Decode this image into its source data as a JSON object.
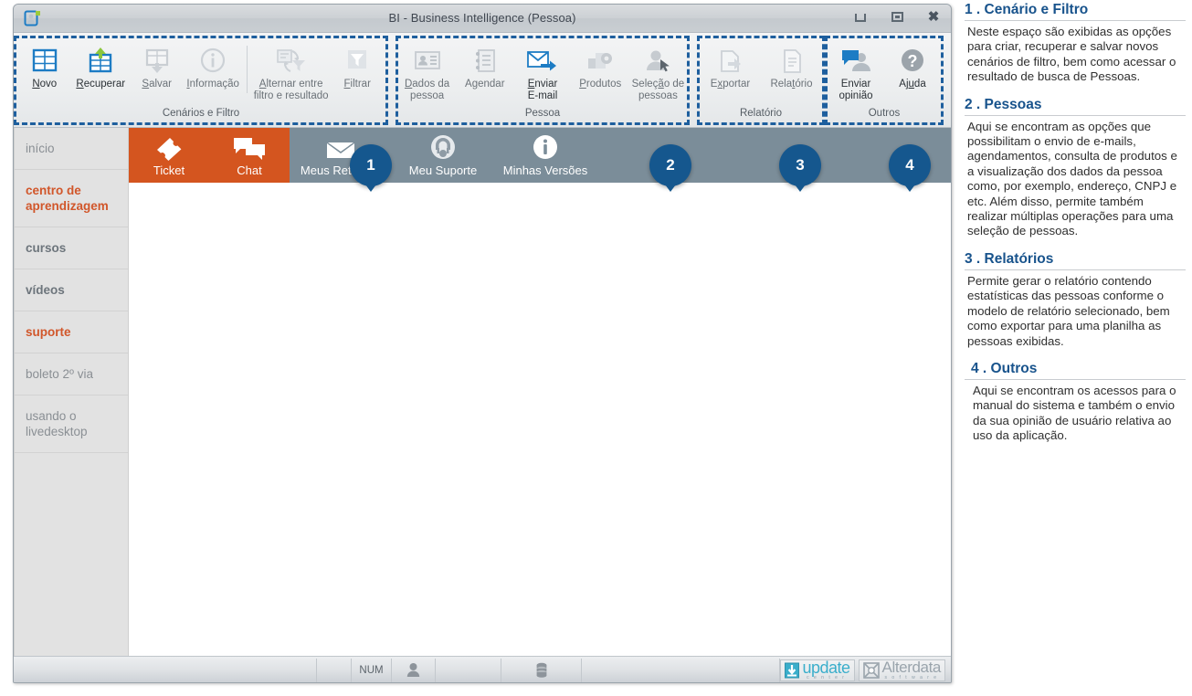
{
  "window": {
    "title": "BI - Business Intelligence (Pessoa)",
    "app_icon": "contact-card-icon",
    "controls": {
      "minimize": "minimize-icon",
      "restore": "restore-icon",
      "close": "close-icon"
    }
  },
  "ribbon": {
    "groups": [
      {
        "id": "cenarios",
        "label": "Cenários e Filtro",
        "badge": "1",
        "buttons": [
          {
            "label": "Novo",
            "accel": "N",
            "icon": "table-new-icon",
            "enabled": true
          },
          {
            "label": "Recuperar",
            "accel": "R",
            "icon": "table-retrieve-icon",
            "enabled": true
          },
          {
            "label": "Salvar",
            "accel": "S",
            "icon": "table-save-icon",
            "enabled": false
          },
          {
            "label": "Informação",
            "accel": "I",
            "icon": "info-circle-icon",
            "enabled": false
          },
          {
            "label": "Alternar entre filtro e resultado",
            "accel": "A",
            "icon": "toggle-filter-result-icon",
            "enabled": false
          },
          {
            "label": "Filtrar",
            "accel": "F",
            "icon": "funnel-icon",
            "enabled": false
          }
        ]
      },
      {
        "id": "pessoa",
        "label": "Pessoa",
        "badge": "2",
        "buttons": [
          {
            "label": "Dados da pessoa",
            "accel": "D",
            "icon": "contact-details-icon",
            "enabled": false
          },
          {
            "label": "Agendar",
            "accel": "g",
            "icon": "agenda-book-icon",
            "enabled": false
          },
          {
            "label": "Enviar E-mail",
            "accel": "E",
            "icon": "send-email-icon",
            "enabled": true
          },
          {
            "label": "Produtos",
            "accel": "P",
            "icon": "products-boxes-icon",
            "enabled": false
          },
          {
            "label": "Seleção de pessoas",
            "accel": "ã",
            "icon": "person-select-icon",
            "enabled": false
          }
        ]
      },
      {
        "id": "relatorios",
        "label": "Relatório",
        "badge": "3",
        "buttons": [
          {
            "label": "Exportar",
            "accel": "x",
            "icon": "export-arrow-icon",
            "enabled": false
          },
          {
            "label": "Relatório",
            "accel": "t",
            "icon": "report-document-icon",
            "enabled": false
          }
        ]
      },
      {
        "id": "outros",
        "label": "Outros",
        "badge": "4",
        "buttons": [
          {
            "label": "Enviar opinião",
            "accel": "v",
            "icon": "feedback-person-icon",
            "enabled": true
          },
          {
            "label": "Ajuda",
            "accel": "u",
            "icon": "help-question-icon",
            "enabled": true
          }
        ]
      }
    ]
  },
  "sidebar": {
    "items": [
      {
        "label": "início",
        "style": "muted"
      },
      {
        "label": "centro de aprendizagem",
        "style": "accent"
      },
      {
        "label": "cursos",
        "style": "strong"
      },
      {
        "label": "vídeos",
        "style": "strong"
      },
      {
        "label": "suporte",
        "style": "accent"
      },
      {
        "label": "boleto 2º via",
        "style": "muted"
      },
      {
        "label": "usando o livedesktop",
        "style": "muted"
      }
    ]
  },
  "tabs": [
    {
      "label": "Ticket",
      "icon": "ticket-icon",
      "active": true
    },
    {
      "label": "Chat",
      "icon": "chat-bubbles-icon",
      "active": true
    },
    {
      "label": "Meus Retornos",
      "icon": "envelope-icon",
      "active": false
    },
    {
      "label": "Meu Suporte",
      "icon": "headset-person-icon",
      "active": false
    },
    {
      "label": "Minhas Versões",
      "icon": "info-circle-icon",
      "active": false
    }
  ],
  "statusbar": {
    "num_indicator": "NUM",
    "user_icon": "user-icon",
    "database_icon": "database-icon",
    "logos": [
      {
        "name": "update",
        "sub": "c e n t e r"
      },
      {
        "name": "Alterdata",
        "sub": "s o f t w a r e"
      }
    ]
  },
  "notes": [
    {
      "heading": "1 . Cenário e Filtro",
      "body": "Neste espaço são exibidas as opções para criar, recuperar e salvar novos cenários de filtro, bem como acessar o resultado de busca de Pessoas."
    },
    {
      "heading": "2 . Pessoas",
      "body": "Aqui se encontram as opções que possibilitam o envio de e-mails, agendamentos, consulta de produtos e a visualização dos dados da pessoa como, por exemplo, endereço, CNPJ e etc. Além disso, permite também realizar múltiplas operações para uma seleção de pessoas."
    },
    {
      "heading": "3 . Relatórios",
      "body": "Permite gerar o relatório contendo estatísticas das pessoas conforme o modelo de relatório selecionado, bem como exportar para uma planilha as pessoas exibidas."
    },
    {
      "heading": "4 . Outros",
      "body": "Aqui se encontram os acessos para o manual do sistema e também o envio da sua opinião de usuário relativa ao uso da aplicação."
    }
  ],
  "colors": {
    "badge_blue": "#15578e",
    "heading_blue": "#18538c",
    "accent_orange": "#d1562a",
    "tab_active": "#d4551f",
    "tabbar_bg": "#7b8d99"
  }
}
